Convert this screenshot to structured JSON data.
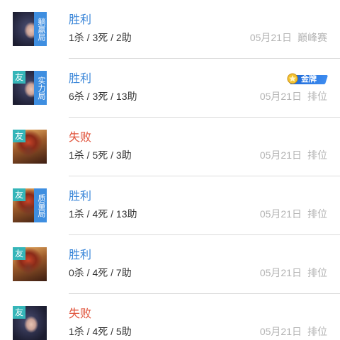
{
  "matches": [
    {
      "hero_icon": "mage-hero-portrait",
      "friend_badge": "",
      "mode_badge": "躺赢局",
      "result": "胜利",
      "outcome": "win",
      "kda": "1杀 / 3死 / 2助",
      "date": "05月21日",
      "match_type": "巅峰赛",
      "rank_badge": ""
    },
    {
      "hero_icon": "mage-hero-portrait",
      "friend_badge": "友",
      "mode_badge": "实力局",
      "result": "胜利",
      "outcome": "win",
      "kda": "6杀 / 3死 / 13助",
      "date": "05月21日",
      "match_type": "排位",
      "rank_badge": "金牌"
    },
    {
      "hero_icon": "warrior-hero-portrait",
      "friend_badge": "友",
      "mode_badge": "",
      "result": "失败",
      "outcome": "loss",
      "kda": "1杀 / 5死 / 3助",
      "date": "05月21日",
      "match_type": "排位",
      "rank_badge": ""
    },
    {
      "hero_icon": "warrior-hero-portrait",
      "friend_badge": "友",
      "mode_badge": "质量局",
      "result": "胜利",
      "outcome": "win",
      "kda": "1杀 / 4死 / 13助",
      "date": "05月21日",
      "match_type": "排位",
      "rank_badge": ""
    },
    {
      "hero_icon": "warrior-hero-portrait",
      "friend_badge": "友",
      "mode_badge": "",
      "result": "胜利",
      "outcome": "win",
      "kda": "0杀 / 4死 / 7助",
      "date": "05月21日",
      "match_type": "排位",
      "rank_badge": ""
    },
    {
      "hero_icon": "mage-hero-portrait",
      "friend_badge": "友",
      "mode_badge": "",
      "result": "失败",
      "outcome": "loss",
      "kda": "1杀 / 4死 / 5助",
      "date": "05月21日",
      "match_type": "排位",
      "rank_badge": ""
    }
  ],
  "colors": {
    "win": "#3a86d8",
    "loss": "#e0533b",
    "friend_badge": "#35b5b8",
    "mode_badge": "#3e8ee0",
    "muted_text": "#b3b3b3"
  }
}
